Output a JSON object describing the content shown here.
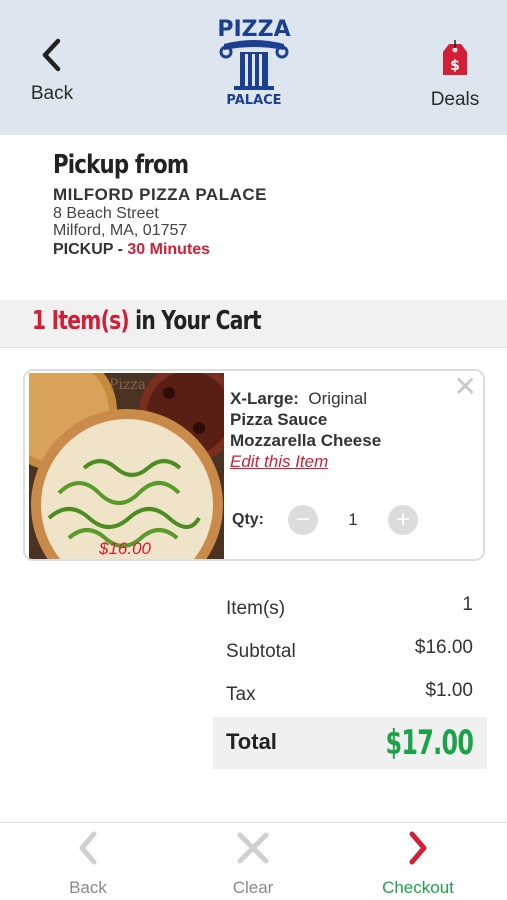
{
  "header": {
    "back_label": "Back",
    "deals_label": "Deals",
    "logo_top": "PIZZA",
    "logo_bottom": "PALACE"
  },
  "pickup": {
    "title": "Pickup from",
    "store_name": "MILFORD PIZZA PALACE",
    "address_line1": "8 Beach Street",
    "address_line2": "Milford, MA, 01757",
    "mode_label": "PICKUP - ",
    "time": "30 Minutes"
  },
  "cart": {
    "count_text": "1 Item(s)",
    "suffix_text": " in Your Cart"
  },
  "item": {
    "size_label": "X-Large:",
    "size_value": "Original",
    "topping1": "Pizza Sauce",
    "topping2": "Mozzarella Cheese",
    "edit_label": "Edit this Item",
    "image_price": "$16.00",
    "image_watermark": "Pizza",
    "qty_label": "Qty:",
    "qty_value": "1",
    "qty_minus": "−",
    "qty_plus": "+",
    "close_glyph": "✕"
  },
  "summary": {
    "items_label": "Item(s)",
    "items_value": "1",
    "subtotal_label": "Subtotal",
    "subtotal_value": "$16.00",
    "tax_label": "Tax",
    "tax_value": "$1.00",
    "total_label": "Total",
    "total_value": "$17.00"
  },
  "bottom_nav": {
    "back_label": "Back",
    "clear_label": "Clear",
    "checkout_label": "Checkout"
  },
  "colors": {
    "accent_red": "#d21f35",
    "accent_green": "#1ca34a",
    "header_bg": "#dde6ee",
    "logo_blue": "#1d3f8f"
  },
  "icons": {
    "back": "chevron-left-icon",
    "deals": "price-tag-icon",
    "clear": "x-icon",
    "checkout": "chevron-right-icon"
  }
}
